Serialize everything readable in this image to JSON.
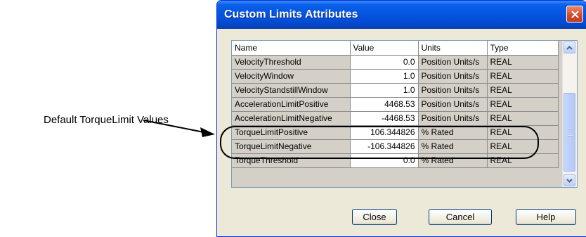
{
  "callout": {
    "label": "Default TorqueLimit Values"
  },
  "dialog": {
    "title": "Custom Limits Attributes",
    "columns": {
      "name": "Name",
      "value": "Value",
      "units": "Units",
      "type": "Type"
    },
    "rows": [
      {
        "name": "VelocityThreshold",
        "value": "0.0",
        "units": "Position Units/s",
        "type": "REAL"
      },
      {
        "name": "VelocityWindow",
        "value": "1.0",
        "units": "Position Units/s",
        "type": "REAL"
      },
      {
        "name": "VelocityStandstillWindow",
        "value": "1.0",
        "units": "Position Units/s",
        "type": "REAL"
      },
      {
        "name": "AccelerationLimitPositive",
        "value": "4468.53",
        "units": "Position Units/s",
        "type": "REAL"
      },
      {
        "name": "AccelerationLimitNegative",
        "value": "-4468.53",
        "units": "Position Units/s",
        "type": "REAL"
      },
      {
        "name": "TorqueLimitPositive",
        "value": "106.344826",
        "units": "% Rated",
        "type": "REAL"
      },
      {
        "name": "TorqueLimitNegative",
        "value": "-106.344826",
        "units": "% Rated",
        "type": "REAL"
      },
      {
        "name": "TorqueThreshold",
        "value": "0.0",
        "units": "% Rated",
        "type": "REAL"
      }
    ],
    "buttons": {
      "close": "Close",
      "cancel": "Cancel",
      "help": "Help"
    }
  },
  "colors": {
    "titlebar": "#0453df",
    "dialog_bg": "#ece9d8",
    "grid_bg": "#d4d0c8",
    "close_btn": "#d4482a"
  },
  "icons": {
    "close": "close-icon",
    "scroll_up": "chevron-up-icon",
    "scroll_down": "chevron-down-icon"
  }
}
